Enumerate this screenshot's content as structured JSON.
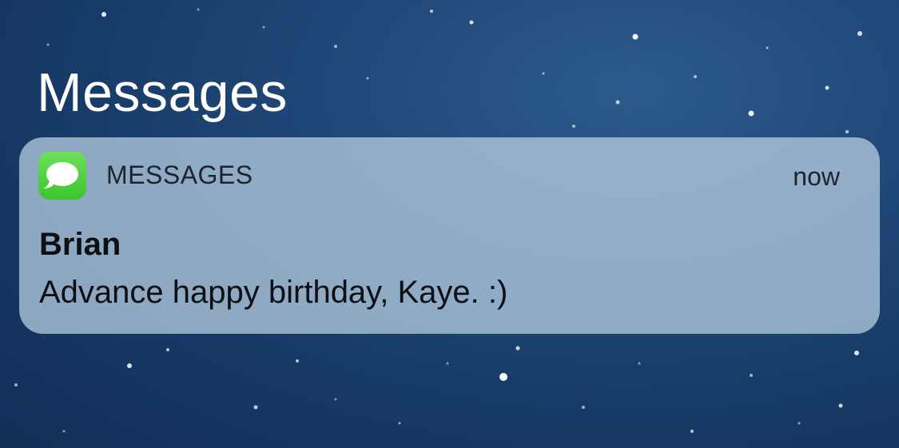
{
  "section": {
    "title": "Messages"
  },
  "notification": {
    "app_icon": "messages-bubble-icon",
    "app_name": "MESSAGES",
    "timestamp": "now",
    "sender": "Brian",
    "body": "Advance happy birthday, Kaye. :)"
  },
  "colors": {
    "background": "#1f4777",
    "card": "#b7cde0",
    "icon_green": "#4cd137",
    "text_dark": "#0c0f14",
    "title_white": "#ffffff"
  }
}
